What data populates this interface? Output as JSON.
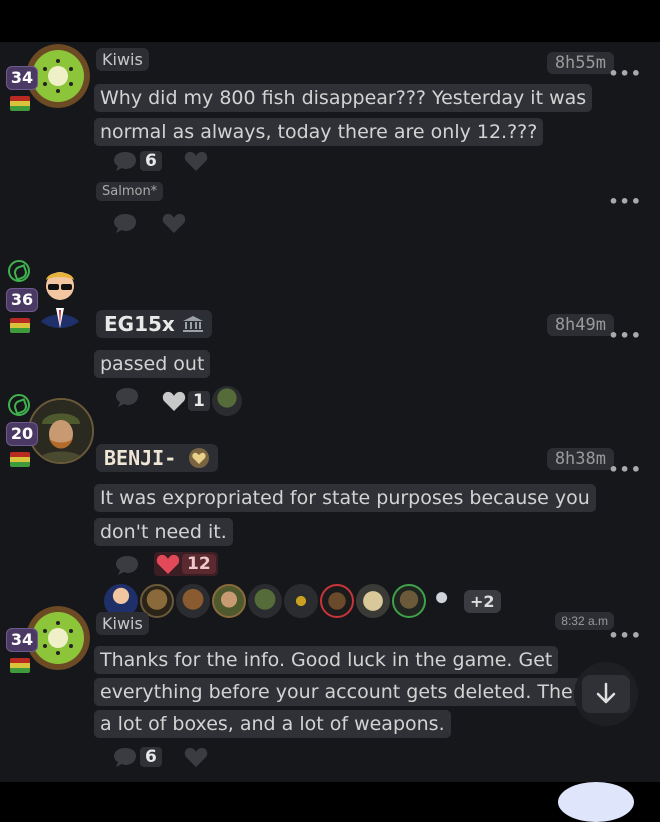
{
  "posts": [
    {
      "author": "Kiwis",
      "level": "34",
      "time": "8h55m",
      "lines": [
        "Why did my 800 fish disappear??? Yesterday it was",
        "normal as always, today there are only 12.???"
      ],
      "comment_count": "6",
      "reply_author": "Salmon*"
    },
    {
      "author": "EG15x",
      "level": "36",
      "time": "8h49m",
      "lines": [
        "passed out"
      ],
      "like_count": "1"
    },
    {
      "author": "BENJI-",
      "level": "20",
      "time": "8h38m",
      "lines": [
        "It was expropriated for state purposes because you",
        "don't need it."
      ],
      "like_count": "12",
      "more_reactors": "+2"
    },
    {
      "author": "Kiwis",
      "level": "34",
      "time": "8:32 a.m",
      "lines": [
        "Thanks for the info. Good luck in the game. Get",
        "everything before your account gets deleted. There are",
        "a lot of boxes, and a lot of weapons."
      ],
      "comment_count": "6"
    }
  ],
  "more_menu": "•••",
  "icons": {
    "comment": "comment-icon",
    "like": "heart-icon",
    "scroll_down": "arrow-down-icon",
    "museum": "bank-icon",
    "heart_badge": "heart-badge-icon"
  },
  "colors": {
    "feed_bg": "#15171b",
    "bubble": "#2f3136",
    "level_badge": "#4a3a63",
    "like_active": "#e24a5a"
  }
}
